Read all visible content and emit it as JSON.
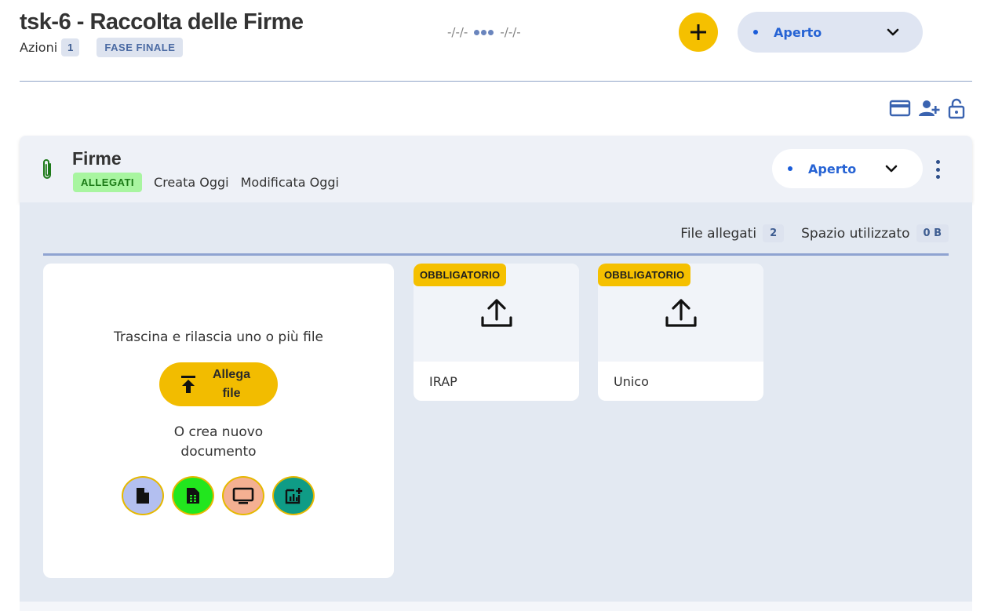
{
  "header": {
    "title": "tsk-6 - Raccolta delle Firme",
    "actions_label": "Azioni",
    "actions_count": "1",
    "phase": "FASE FINALE",
    "date_start": "-/-/-",
    "date_end": "-/-/-",
    "add_label": "+",
    "status": "Aperto"
  },
  "toolbar": {
    "icons": [
      "credit-card-icon",
      "add-user-icon",
      "lock-icon"
    ]
  },
  "section": {
    "title": "Firme",
    "type_chip": "ALLEGATI",
    "created": "Creata Oggi",
    "modified": "Modificata Oggi",
    "status": "Aperto"
  },
  "stats": {
    "files_label": "File allegati",
    "files_count": "2",
    "space_label": "Spazio utilizzato",
    "space_value": "0 B"
  },
  "dropzone": {
    "drag_text": "Trascina e rilascia uno o più file",
    "attach_label": "Allega file",
    "create_line1": "O crea nuovo",
    "create_line2": "documento",
    "doc_types": [
      "document-icon",
      "spreadsheet-icon",
      "presentation-icon",
      "chart-icon"
    ]
  },
  "files": [
    {
      "badge": "OBBLIGATORIO",
      "name": "IRAP"
    },
    {
      "badge": "OBBLIGATORIO",
      "name": "Unico"
    }
  ],
  "colors": {
    "accent_yellow": "#f5c000",
    "status_blue": "#2663d4",
    "panel_bg": "#e3e9f2",
    "green_chip": "#a8f5a0"
  }
}
